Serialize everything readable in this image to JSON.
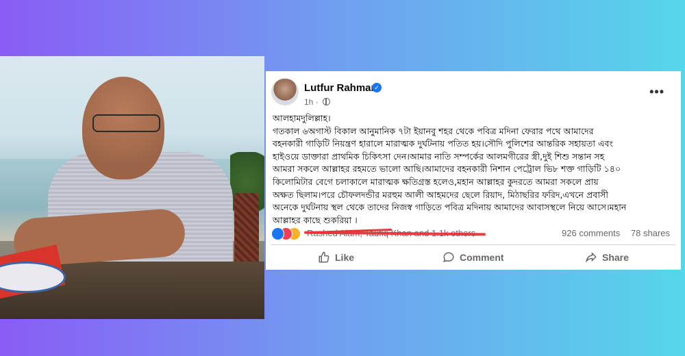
{
  "post": {
    "author": "Lutfur Rahman",
    "verified_mark": "✓",
    "time": "1h",
    "visibility_icon": "globe-icon",
    "more_icon": "•••",
    "text": "আলহামদুলিল্লাহ।\nগতকাল ৬অগাস্ট বিকাল আনুমানিক ৭টা ইয়ানবু শহর থেকে পবিত্র মদিনা ফেরার পথে আমাদের\nবহনকারী গাড়িটি নিয়ন্ত্রণ হারালে মারাত্মক দুর্ঘটনায় পতিত হয়।সৌদি পুলিশের আন্তরিক সহায়তা এবং\nহাইওয়ে ডাক্তারা প্রাথমিক চিকিৎসা দেন।আমার নাতি সম্পর্কের আলমগীরের স্ত্রী,দুই শিশু সন্তান সহ\nআমরা সকলে আল্লাহর রহমতে ভালো আছি।আমাদের বহনকারী নিশান পেট্রোল ভি৮ শক্ত গাড়িটি ১৪০\nকিলোমিটার বেগে চলাকালে মারাত্মক ক্ষতিগ্রস্ত হলেও,মহান আল্লাহর কুদরতে আমরা সকলে প্রায়\nঅক্ষত ছিলাম।পরে চৌফলদন্ডীর মরহুম আলী আহমদের ছেলে রিয়াদ, মিঠাছরির ফরিদ,এখনে প্রবাসী\nঅনেকে দুর্ঘটনায় স্থল থেকে তাদের নিজস্ব গাড়িতে পবিত্র মদিনায় আমাদের আবাসস্থলে নিয়ে আসে।মহান\nআল্লাহর কাছে শুকরিয়া ।"
  },
  "reactions": {
    "icons": [
      "like-icon",
      "love-icon",
      "care-icon"
    ],
    "names": "Rashed Alam, Taufiq Khan and 1.1k others",
    "comments": "926 comments",
    "shares": "78 shares",
    "colors": {
      "like": "#1877f2",
      "love": "#f33e58",
      "care": "#f7b125",
      "redaction": "#e8333a"
    }
  },
  "actions": {
    "like": "Like",
    "comment": "Comment",
    "share": "Share"
  }
}
